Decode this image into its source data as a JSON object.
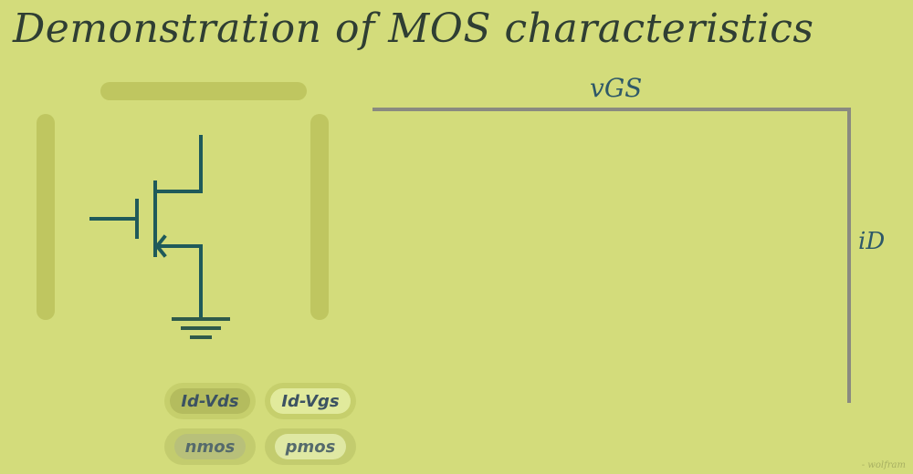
{
  "title": "Demonstration of MOS characteristics",
  "plot": {
    "x_axis_label": "vGS",
    "y_axis_label": "iD"
  },
  "buttons": {
    "id_vds": "Id-Vds",
    "id_vgs": "Id-Vgs",
    "nmos": "nmos",
    "pmos": "pmos"
  },
  "credit": "- wolfram",
  "colors": {
    "background": "#d3dc7b",
    "slider_track": "#bfc660",
    "circuit": "#1f5a5a",
    "axis": "#8a8a80",
    "title": "#2f3e33"
  }
}
